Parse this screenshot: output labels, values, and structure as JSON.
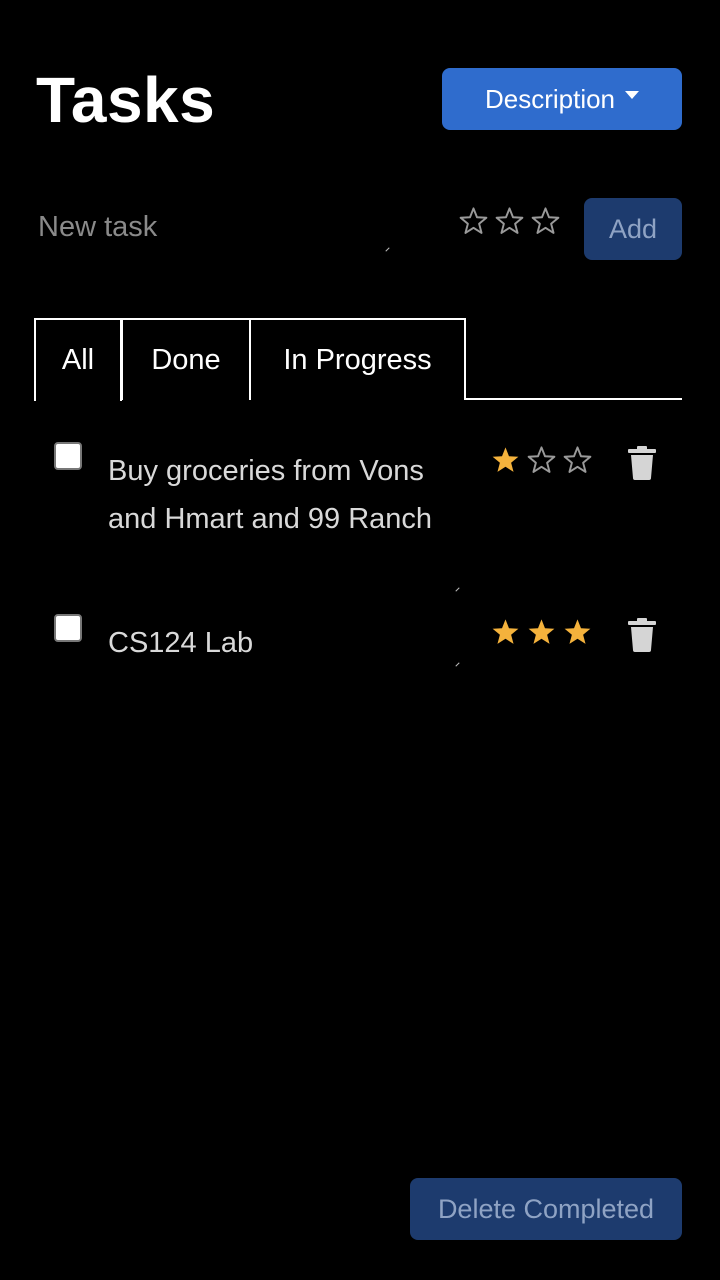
{
  "header": {
    "title": "Tasks",
    "sort_label": "Description"
  },
  "new_task": {
    "placeholder": "New task",
    "rating": 0,
    "max_rating": 3,
    "add_label": "Add"
  },
  "tabs": [
    {
      "label": "All",
      "selected": true
    },
    {
      "label": "Done",
      "selected": false
    },
    {
      "label": "In Progress",
      "selected": false
    }
  ],
  "tasks": [
    {
      "text": "Buy groceries from Vons and Hmart and 99 Ranch",
      "done": false,
      "rating": 1,
      "max_rating": 3
    },
    {
      "text": "CS124 Lab",
      "done": false,
      "rating": 3,
      "max_rating": 3
    }
  ],
  "footer": {
    "delete_completed_label": "Delete Completed"
  },
  "colors": {
    "accent": "#2f6ccd",
    "disabled_button": "#1d3b6e",
    "star_filled": "#f4b23c",
    "star_outline": "#9a9a9a"
  },
  "icons": {
    "sort_caret": "caret-down-icon",
    "star_empty": "star-outline-icon",
    "star_filled": "star-filled-icon",
    "delete": "trash-icon"
  }
}
